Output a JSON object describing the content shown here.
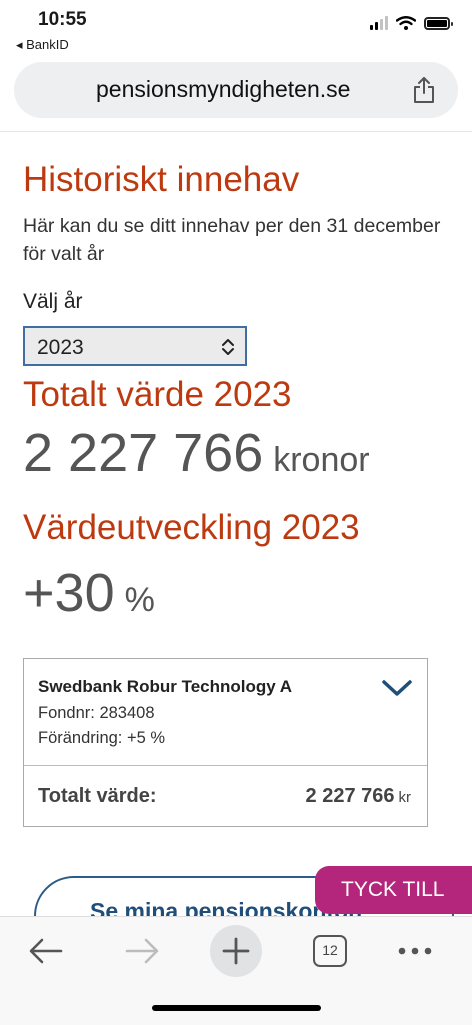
{
  "status_bar": {
    "time": "10:55",
    "back_app": "◂ BankID"
  },
  "browser": {
    "url": "pensionsmyndigheten.se"
  },
  "page": {
    "title": "Historiskt innehav",
    "intro": "Här kan du se ditt innehav per den 31 december för valt år",
    "year_label": "Välj år",
    "year_selected": "2023",
    "total_heading": "Totalt värde 2023",
    "total_value": "2 227 766",
    "total_unit": "kronor",
    "development_heading": "Värdeutveckling 2023",
    "development_value": "+30",
    "development_unit": "%"
  },
  "fund": {
    "name": "Swedbank Robur Technology A",
    "fund_number": "Fondnr: 283408",
    "change": "Förändring: +5 %",
    "total_label": "Totalt värde:",
    "total_value": "2 227 766",
    "total_unit": "kr"
  },
  "actions": {
    "pension_button": "Se mina pensionskonton",
    "feedback": "TYCK TILL"
  },
  "toolbar": {
    "tab_count": "12"
  },
  "colors": {
    "accent_red": "#bd3a10",
    "link_blue": "#1f4e7a",
    "feedback_pink": "#b4267b"
  }
}
